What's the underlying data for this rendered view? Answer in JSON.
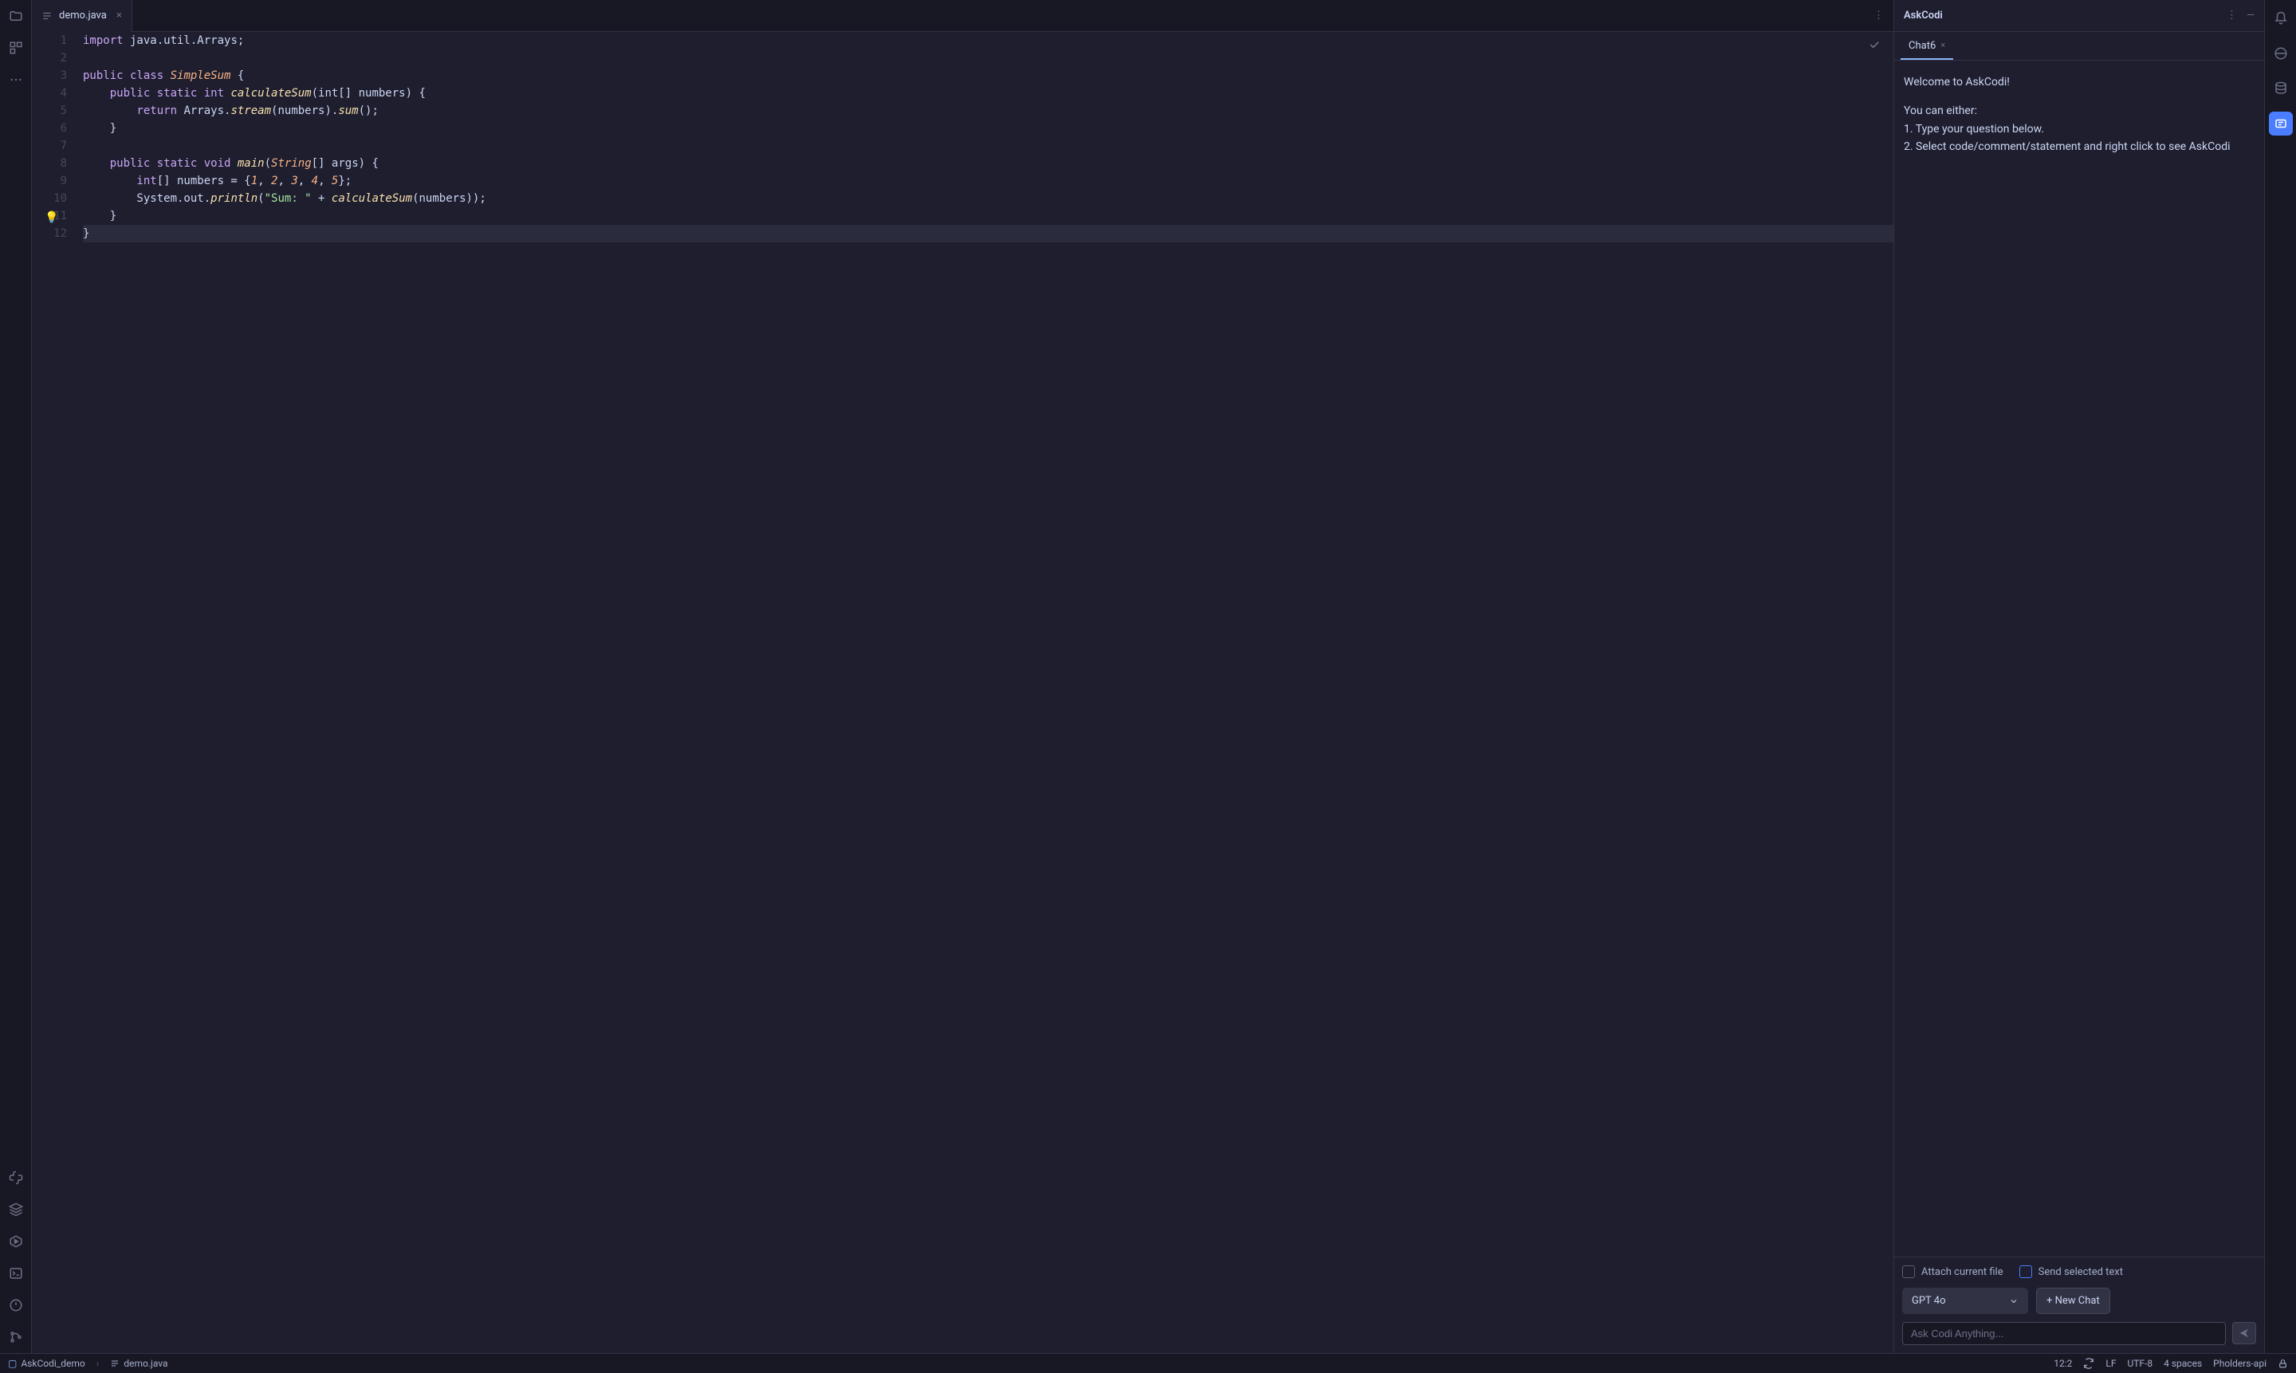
{
  "tab": {
    "filename": "demo.java"
  },
  "editor": {
    "cursor_position": "12:2",
    "lines": [
      {
        "n": 1
      },
      {
        "n": 2
      },
      {
        "n": 3
      },
      {
        "n": 4
      },
      {
        "n": 5
      },
      {
        "n": 6
      },
      {
        "n": 7
      },
      {
        "n": 8
      },
      {
        "n": 9
      },
      {
        "n": 10
      },
      {
        "n": 11
      },
      {
        "n": 12
      }
    ],
    "code": {
      "l1_import": "import",
      "l1_pkg": " java.util.Arrays;",
      "l3_public": "public",
      "l3_class": " class",
      "l3_name": " SimpleSum",
      "l3_brace": " {",
      "l4_mod": "    public static",
      "l4_int": " int",
      "l4_fn": " calculateSum",
      "l4_params": "(int[] numbers) {",
      "l5_return": "        return",
      "l5_arrays": " Arrays.",
      "l5_stream": "stream",
      "l5_mid": "(numbers).",
      "l5_sum": "sum",
      "l5_end": "();",
      "l6": "    }",
      "l8_mod": "    public static",
      "l8_void": " void",
      "l8_main": " main",
      "l8_p1": "(",
      "l8_string": "String",
      "l8_p2": "[] args) {",
      "l9_int": "        int",
      "l9_decl": "[] numbers = {",
      "l9_n1": "1",
      "l9_c1": ", ",
      "l9_n2": "2",
      "l9_c2": ", ",
      "l9_n3": "3",
      "l9_c3": ", ",
      "l9_n4": "4",
      "l9_c4": ", ",
      "l9_n5": "5",
      "l9_end": "};",
      "l10_pre": "        System.out.",
      "l10_println": "println",
      "l10_p1": "(",
      "l10_str": "\"Sum: \"",
      "l10_plus": " + ",
      "l10_fn": "calculateSum",
      "l10_end": "(numbers));",
      "l11": "    }",
      "l12": "}"
    }
  },
  "askcodi": {
    "title": "AskCodi",
    "chat_tab": "Chat6",
    "welcome": "Welcome to AskCodi!",
    "either": "You can either:",
    "opt1": "1. Type your question below.",
    "opt2": "2. Select code/comment/statement and right click to see AskCodi",
    "attach_label": "Attach current file",
    "send_selected_label": "Send selected text",
    "model": "GPT 4o",
    "new_chat": "+ New Chat",
    "input_placeholder": "Ask Codi Anything..."
  },
  "status": {
    "project": "AskCodi_demo",
    "file": "demo.java",
    "line_ending": "LF",
    "encoding": "UTF-8",
    "indent": "4 spaces",
    "api": "Pholders-api"
  }
}
